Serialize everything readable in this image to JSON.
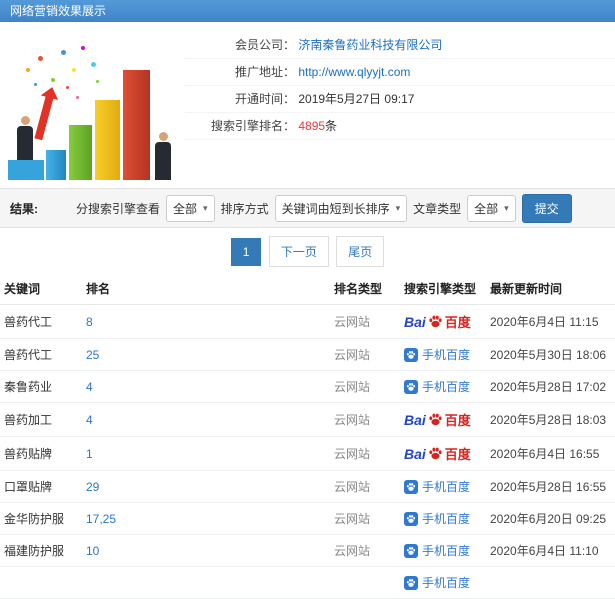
{
  "topbar": {
    "title": "网络营销效果展示"
  },
  "info": {
    "company_label": "会员公司：",
    "company_value": "济南秦鲁药业科技有限公司",
    "url_label": "推广地址：",
    "url_value": "http://www.qlyyjt.com",
    "time_label": "开通时间：",
    "time_value": "2019年5月27日 09:17",
    "rank_label": "搜索引擎排名：",
    "rank_value": "4895",
    "rank_suffix": "条"
  },
  "filters": {
    "result_label": "结果:",
    "engine_label": "分搜索引擎查看",
    "engine_value": "全部",
    "sort_label": "排序方式",
    "sort_value": "关键词由短到长排序",
    "article_label": "文章类型",
    "article_value": "全部",
    "submit_label": "提交"
  },
  "pagination": {
    "current": "1",
    "next": "下一页",
    "last": "尾页"
  },
  "table": {
    "headers": [
      "关键词",
      "排名",
      "排名类型",
      "搜索引擎类型",
      "最新更新时间"
    ],
    "rows": [
      {
        "keyword": "兽药代工",
        "rank": "8",
        "rank_type": "云网站",
        "engine": "baidu",
        "time": "2020年6月4日 11:15"
      },
      {
        "keyword": "兽药代工",
        "rank": "25",
        "rank_type": "云网站",
        "engine": "mobile",
        "time": "2020年5月30日 18:06"
      },
      {
        "keyword": "秦鲁药业",
        "rank": "4",
        "rank_type": "云网站",
        "engine": "mobile",
        "time": "2020年5月28日 17:02"
      },
      {
        "keyword": "兽药加工",
        "rank": "4",
        "rank_type": "云网站",
        "engine": "baidu",
        "time": "2020年5月28日 18:03"
      },
      {
        "keyword": "兽药贴牌",
        "rank": "1",
        "rank_type": "云网站",
        "engine": "baidu",
        "time": "2020年6月4日 16:55"
      },
      {
        "keyword": "口罩贴牌",
        "rank": "29",
        "rank_type": "云网站",
        "engine": "mobile",
        "time": "2020年5月28日 16:55"
      },
      {
        "keyword": "金华防护服",
        "rank": "17,25",
        "rank_type": "云网站",
        "engine": "mobile",
        "time": "2020年6月20日 09:25"
      },
      {
        "keyword": "福建防护服",
        "rank": "10",
        "rank_type": "云网站",
        "engine": "mobile",
        "time": "2020年6月4日 11:10"
      },
      {
        "keyword": "",
        "rank": "",
        "rank_type": "",
        "engine": "mobile",
        "time": ""
      }
    ]
  },
  "engines": {
    "baidu": {
      "text_latin": "Bai",
      "text_cn": "百度",
      "icon": "paw-icon"
    },
    "mobile": {
      "label": "手机百度",
      "icon": "mobile-baidu-icon"
    }
  },
  "theme": {
    "topbar_bg": "#4489ce",
    "link_blue": "#1b6ec2",
    "highlight_red": "#e23c3c",
    "button_blue": "#337ab7",
    "baidu_red": "#d9231f",
    "baidu_blue": "#2544c8",
    "mobile_blue": "#2f7ad0"
  }
}
